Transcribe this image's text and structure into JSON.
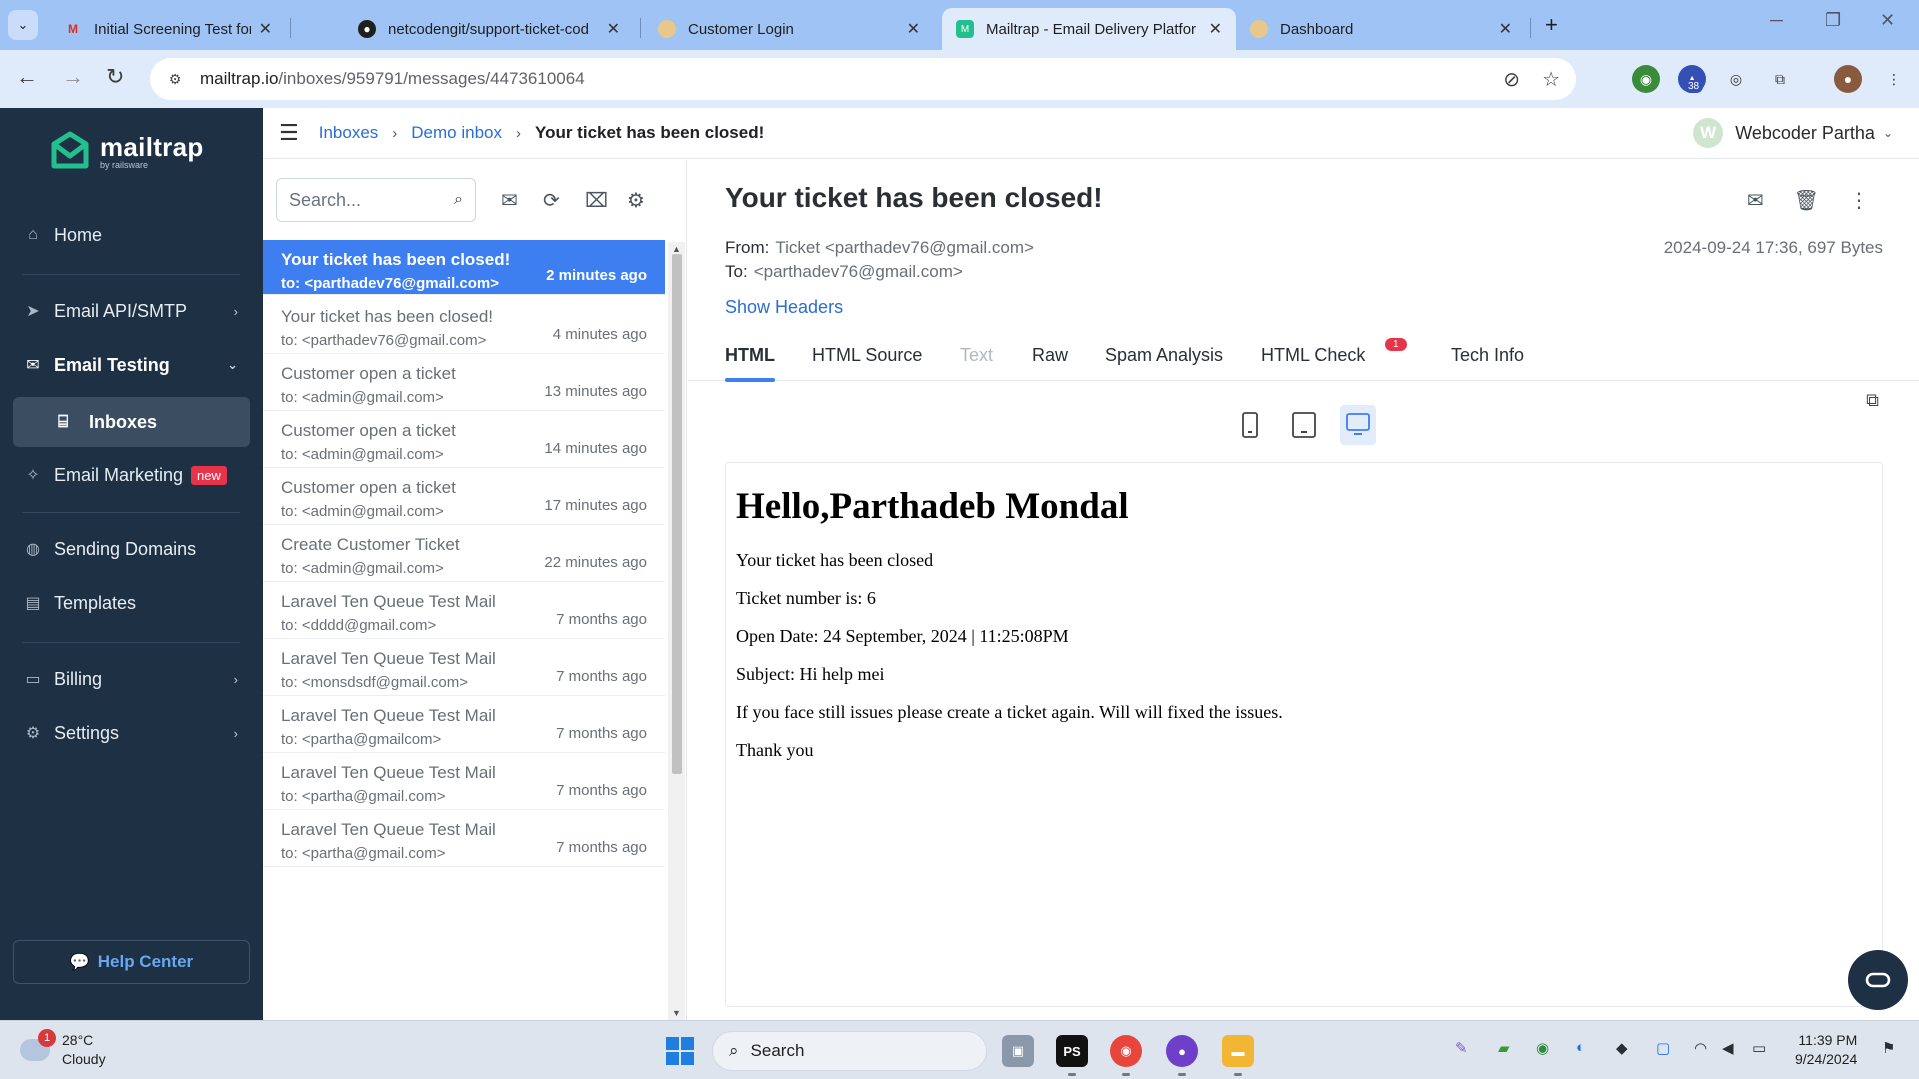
{
  "browser": {
    "tabs": [
      {
        "title": "Initial Screening Test for \"Midle",
        "favicon": "gmail-icon"
      },
      {
        "title": "netcodengit/support-ticket-cod",
        "favicon": "github-icon"
      },
      {
        "title": "Customer Login",
        "favicon": "page-icon"
      },
      {
        "title": "Mailtrap - Email Delivery Platfor",
        "favicon": "mailtrap-icon"
      },
      {
        "title": "Dashboard",
        "favicon": "page-icon"
      }
    ],
    "url_host": "mailtrap.io",
    "url_path": "/inboxes/959791/messages/4473610064",
    "extension_badge": "38"
  },
  "sidebar": {
    "logo_text": "mailtrap",
    "logo_sub": "by railsware",
    "items": {
      "home": "Home",
      "email_api": "Email API/SMTP",
      "email_testing": "Email Testing",
      "inboxes": "Inboxes",
      "email_marketing": "Email Marketing",
      "new_badge": "new",
      "sending_domains": "Sending Domains",
      "templates": "Templates",
      "billing": "Billing",
      "settings": "Settings"
    },
    "help": "Help Center"
  },
  "header": {
    "breadcrumbs": [
      "Inboxes",
      "Demo inbox",
      "Your ticket has been closed!"
    ],
    "user_initial": "W",
    "user_name": "Webcoder Partha"
  },
  "list": {
    "search_placeholder": "Search...",
    "messages": [
      {
        "subject": "Your ticket has been closed!",
        "to": "to: <parthadev76@gmail.com>",
        "time": "2 minutes ago"
      },
      {
        "subject": "Your ticket has been closed!",
        "to": "to: <parthadev76@gmail.com>",
        "time": "4 minutes ago"
      },
      {
        "subject": "Customer open a ticket",
        "to": "to: <admin@gmail.com>",
        "time": "13 minutes ago"
      },
      {
        "subject": "Customer open a ticket",
        "to": "to: <admin@gmail.com>",
        "time": "14 minutes ago"
      },
      {
        "subject": "Customer open a ticket",
        "to": "to: <admin@gmail.com>",
        "time": "17 minutes ago"
      },
      {
        "subject": "Create Customer Ticket",
        "to": "to: <admin@gmail.com>",
        "time": "22 minutes ago"
      },
      {
        "subject": "Laravel Ten Queue Test Mail",
        "to": "to: <dddd@gmail.com>",
        "time": "7 months ago"
      },
      {
        "subject": "Laravel Ten Queue Test Mail",
        "to": "to: <monsdsdf@gmail.com>",
        "time": "7 months ago"
      },
      {
        "subject": "Laravel Ten Queue Test Mail",
        "to": "to: <partha@gmailcom>",
        "time": "7 months ago"
      },
      {
        "subject": "Laravel Ten Queue Test Mail",
        "to": "to: <partha@gmail.com>",
        "time": "7 months ago"
      },
      {
        "subject": "Laravel Ten Queue Test Mail",
        "to": "to: <partha@gmail.com>",
        "time": "7 months ago"
      }
    ]
  },
  "detail": {
    "title": "Your ticket has been closed!",
    "from_label": "From:",
    "from_value": "Ticket <parthadev76@gmail.com>",
    "to_label": "To:",
    "to_value": "<parthadev76@gmail.com>",
    "date": "2024-09-24 17:36, 697 Bytes",
    "show_headers": "Show Headers",
    "tabs": {
      "html": "HTML",
      "html_source": "HTML Source",
      "text": "Text",
      "raw": "Raw",
      "spam": "Spam Analysis",
      "html_check": "HTML Check",
      "html_check_badge": "1",
      "tech": "Tech Info"
    },
    "body": {
      "heading": "Hello,Parthadeb Mondal",
      "p1": "Your ticket has been closed",
      "p2": "Ticket number is: 6",
      "p3": "Open Date: 24 September, 2024 | 11:25:08PM",
      "p4": "Subject: Hi help mei",
      "p5": "If you face still issues please create a ticket again. Will will fixed the issues.",
      "p6": "Thank you"
    }
  },
  "taskbar": {
    "weather_alert": "1",
    "temp": "28°C",
    "condition": "Cloudy",
    "search": "Search",
    "time": "11:39 PM",
    "date": "9/24/2024"
  },
  "colors": {
    "sidebar_bg": "#1e3044",
    "accent_blue": "#3d7ef0",
    "badge_red": "#e6344a"
  }
}
